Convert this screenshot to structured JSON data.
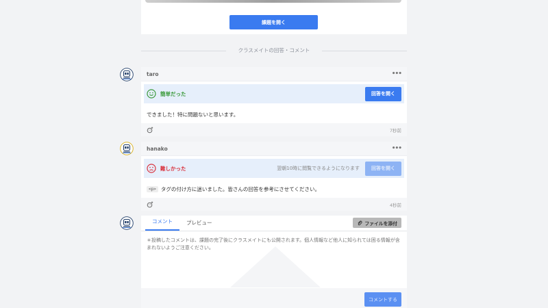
{
  "task": {
    "open_button_label": "課題を開く"
  },
  "divider": {
    "label": "クラスメイトの回答・コメント"
  },
  "answers": [
    {
      "username": "taro",
      "status_label": "簡単だった",
      "status_color": "#3b9a3b",
      "answer_button_label": "回答を開く",
      "body": "できました！特に問題ないと思います。",
      "time": "7秒前"
    },
    {
      "username": "hanako",
      "status_label": "難しかった",
      "status_color": "#d9333f",
      "reveal_note": "翌朝10時に閲覧できるようになります",
      "answer_button_label": "回答を開く",
      "code_tag": "<p>",
      "body": "タグの付け方に迷いました。皆さんの回答を参考にさせてください。",
      "time": "4秒前"
    }
  ],
  "comment_form": {
    "tab_comment": "コメント",
    "tab_preview": "プレビュー",
    "attach_label": "ファイルを添付",
    "placeholder": "＊投稿したコメントは、課題の完了後にクラスメイトにも公開されます。個人情報など他人に知られては困る情報が含まれないようご注意ください。",
    "submit_label": "コメントする"
  },
  "colors": {
    "accent": "#3a7bf0",
    "easy": "#3b9a3b",
    "hard": "#d9333f"
  }
}
